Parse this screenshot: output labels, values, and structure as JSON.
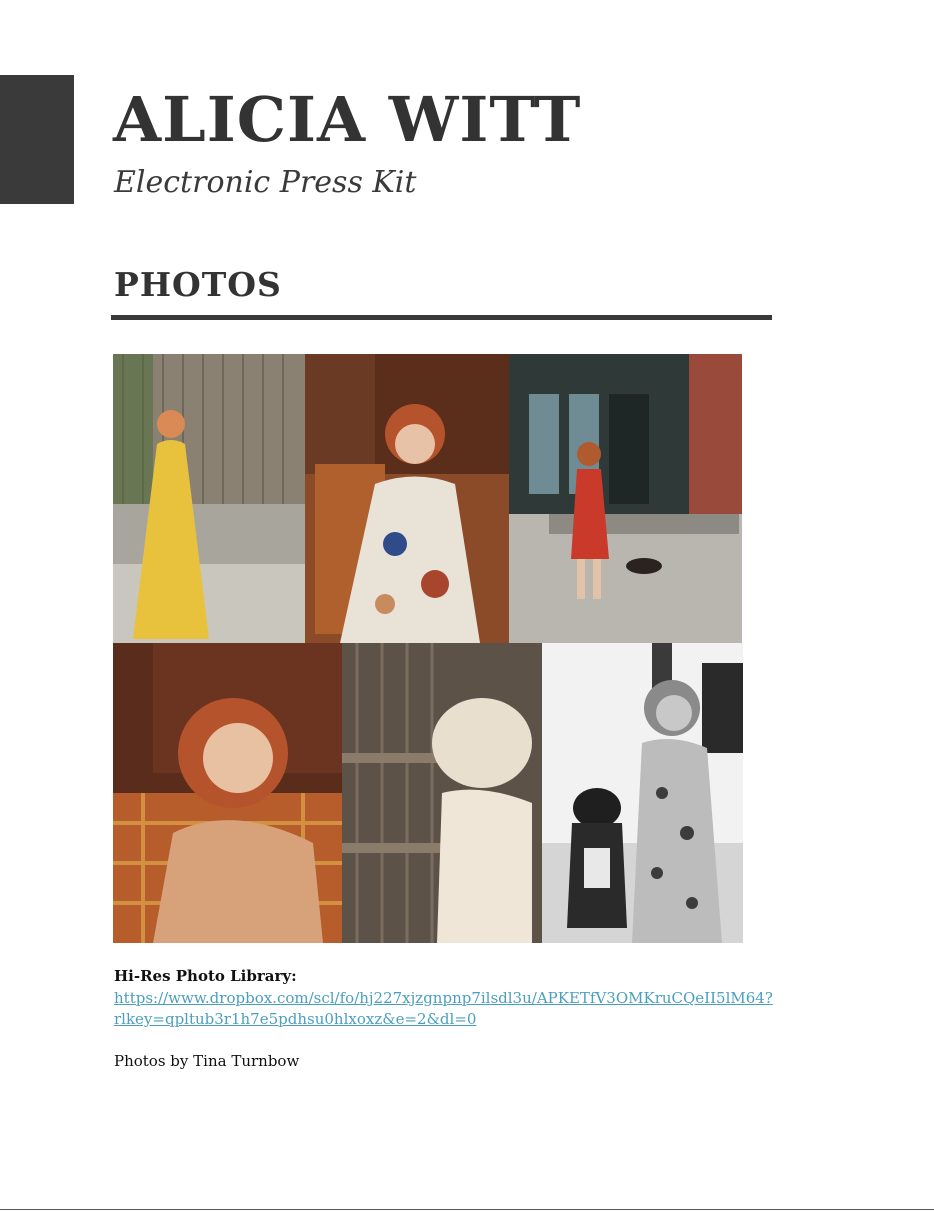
{
  "header": {
    "title": "ALICIA WITT",
    "subtitle": "Electronic Press Kit"
  },
  "section": {
    "heading": "PHOTOS"
  },
  "photos": [
    {
      "name": "photo-yellow-dress",
      "palette": [
        "#8a8478",
        "#e8c23c",
        "#c9c6bd"
      ]
    },
    {
      "name": "photo-floral-dress-chair",
      "palette": [
        "#6b3a24",
        "#e9e2d6",
        "#b0602d"
      ]
    },
    {
      "name": "photo-red-dress-dog-street",
      "palette": [
        "#2f3a38",
        "#c93a2a",
        "#b9b6b0"
      ]
    },
    {
      "name": "photo-portrait-plaid-chair",
      "palette": [
        "#5a2c1c",
        "#d7a27a",
        "#b75c2b"
      ]
    },
    {
      "name": "photo-sepia-fence",
      "palette": [
        "#5d5247",
        "#efe6d8",
        "#8a7b6b"
      ]
    },
    {
      "name": "photo-bw-with-dog",
      "palette": [
        "#f2f2f2",
        "#2a2a2a",
        "#bcbcbc"
      ]
    }
  ],
  "library": {
    "label": "Hi-Res Photo Library:",
    "url": "https://www.dropbox.com/scl/fo/hj227xjzgnpnp7ilsdl3u/APKETfV3OMKruCQeII5lM64?rlkey=qpltub3r1h7e5pdhsu0hlxoxz&e=2&dl=0"
  },
  "credit": "Photos by Tina Turnbow"
}
